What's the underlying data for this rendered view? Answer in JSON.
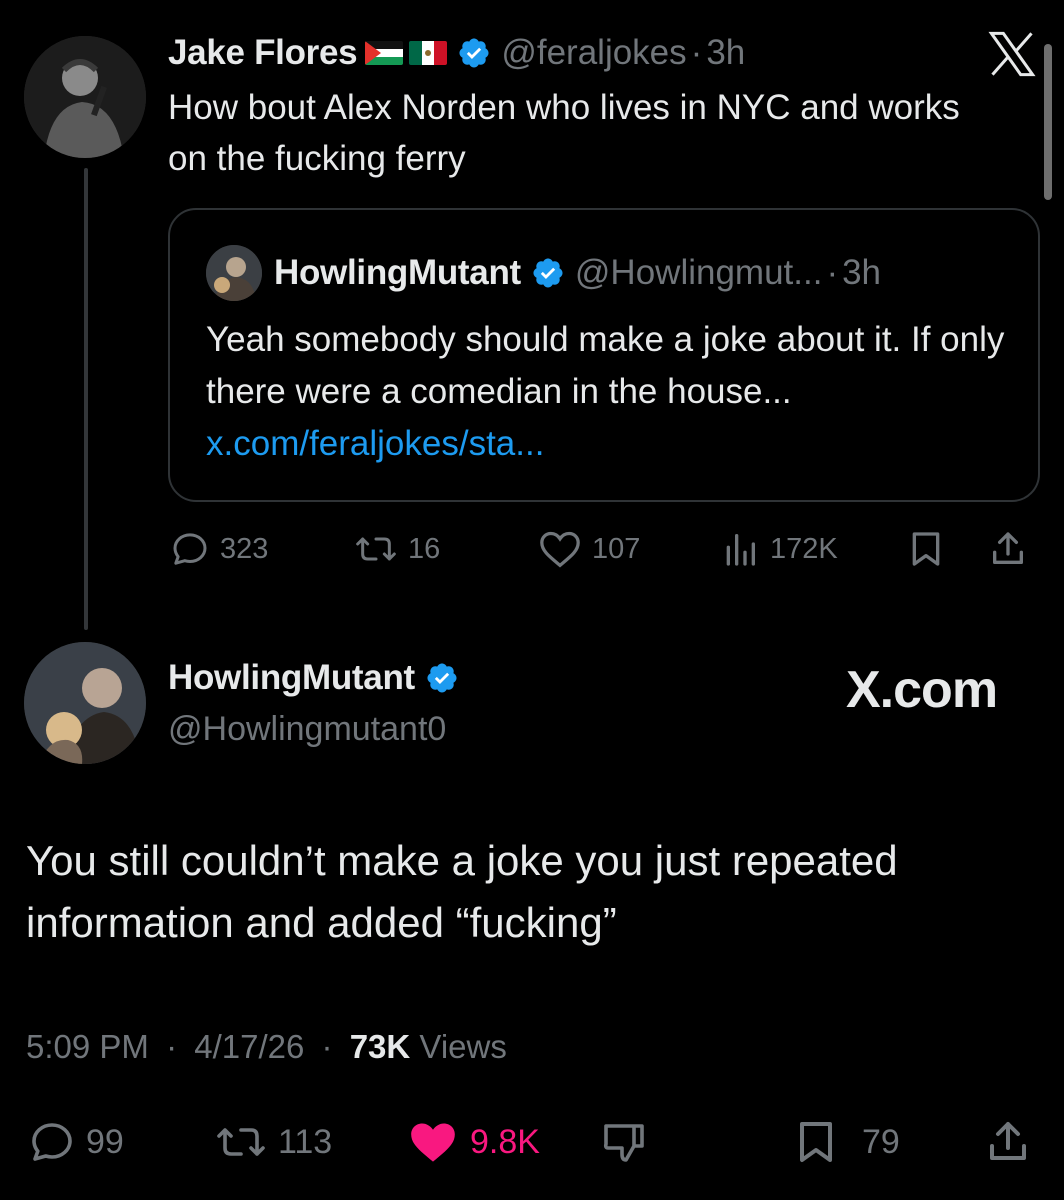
{
  "tweet1": {
    "name": "Jake Flores",
    "handle": "@feraljokes",
    "time": "3h",
    "flags": [
      "palestine-flag",
      "mexico-flag"
    ],
    "text": "How bout Alex Norden who lives in NYC and works on the fucking ferry",
    "quote": {
      "name": "HowlingMutant",
      "handle": "@Howlingmut...",
      "time": "3h",
      "text": "Yeah somebody should make a joke about it.  If only there were a comedian in the house... ",
      "link": "x.com/feraljokes/sta..."
    },
    "actions": {
      "replies": "323",
      "reposts": "16",
      "likes": "107",
      "views": "172K"
    }
  },
  "tweet2": {
    "name": "HowlingMutant",
    "handle": "@Howlingmutant0",
    "brand": "X.com",
    "text": "You still couldn’t make a joke you just repeated information and added “fucking”",
    "time": "5:09 PM",
    "date": "4/17/26",
    "views_count": "73K",
    "views_label": "Views",
    "actions": {
      "replies": "99",
      "reposts": "113",
      "likes": "9.8K",
      "bookmarks": "79"
    }
  },
  "separator": "·",
  "colors": {
    "background": "#000000",
    "text": "#e7e9ea",
    "secondary": "#71767b",
    "link": "#1d9bf0",
    "verified": "#1d9bf0",
    "like_active": "#f91880",
    "border": "#2f3336"
  }
}
